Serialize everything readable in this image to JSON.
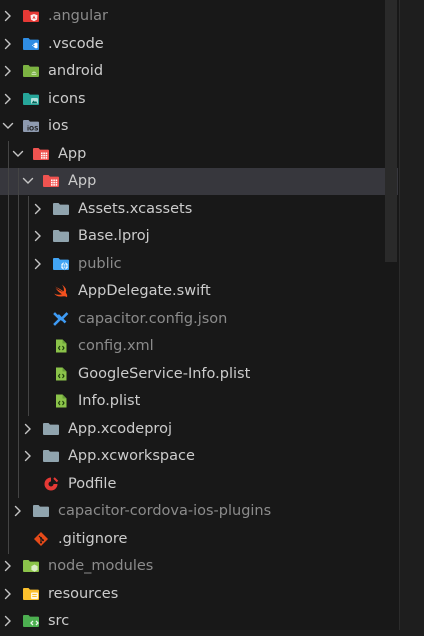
{
  "colors": {
    "background": "#181818",
    "selected_row": "#37373d",
    "text": "#cccccc",
    "text_dim": "#8b8b8b",
    "chevron": "#c5c5c5"
  },
  "tree": {
    "items": [
      {
        "name": "angular-folder",
        "label": ".angular",
        "depth": 0,
        "chevron": "right",
        "icon": "angular-folder-icon",
        "icon_color": "#e53935",
        "dim": true
      },
      {
        "name": "vscode-folder",
        "label": ".vscode",
        "depth": 0,
        "chevron": "right",
        "icon": "vscode-folder-icon",
        "icon_color": "#2f8de4",
        "dim": false
      },
      {
        "name": "android-folder",
        "label": "android",
        "depth": 0,
        "chevron": "right",
        "icon": "android-folder-icon",
        "icon_color": "#7cb342",
        "dim": false
      },
      {
        "name": "icons-folder",
        "label": "icons",
        "depth": 0,
        "chevron": "right",
        "icon": "images-folder-icon",
        "icon_color": "#26a69a",
        "dim": false
      },
      {
        "name": "ios-folder",
        "label": "ios",
        "depth": 0,
        "chevron": "down",
        "icon": "ios-folder-icon",
        "icon_color": "#8e9aaf",
        "dim": false
      },
      {
        "name": "app-folder",
        "label": "App",
        "depth": 1,
        "chevron": "down",
        "icon": "app-folder-icon",
        "icon_color": "#ef5350",
        "dim": false
      },
      {
        "name": "app-subfolder",
        "label": "App",
        "depth": 2,
        "chevron": "down",
        "icon": "app-folder-icon",
        "icon_color": "#ef5350",
        "dim": false,
        "selected": true
      },
      {
        "name": "assets-xcassets-folder",
        "label": "Assets.xcassets",
        "depth": 3,
        "chevron": "right",
        "icon": "folder-icon",
        "icon_color": "#90a4ae",
        "dim": false
      },
      {
        "name": "base-lproj-folder",
        "label": "Base.lproj",
        "depth": 3,
        "chevron": "right",
        "icon": "folder-icon",
        "icon_color": "#90a4ae",
        "dim": false
      },
      {
        "name": "public-folder",
        "label": "public",
        "depth": 3,
        "chevron": "right",
        "icon": "public-folder-icon",
        "icon_color": "#42a5f5",
        "dim": true
      },
      {
        "name": "appdelegate-file",
        "label": "AppDelegate.swift",
        "depth": 3,
        "chevron": "none",
        "icon": "swift-icon",
        "icon_color": "#f4511e",
        "dim": false
      },
      {
        "name": "capacitor-config-file",
        "label": "capacitor.config.json",
        "depth": 3,
        "chevron": "none",
        "icon": "capacitor-icon",
        "icon_color": "#3e9bf5",
        "dim": true
      },
      {
        "name": "config-xml-file",
        "label": "config.xml",
        "depth": 3,
        "chevron": "none",
        "icon": "xml-file-icon",
        "icon_color": "#8bc34a",
        "dim": true
      },
      {
        "name": "googleservice-plist-file",
        "label": "GoogleService-Info.plist",
        "depth": 3,
        "chevron": "none",
        "icon": "plist-file-icon",
        "icon_color": "#8bc34a",
        "dim": false
      },
      {
        "name": "info-plist-file",
        "label": "Info.plist",
        "depth": 3,
        "chevron": "none",
        "icon": "plist-file-icon",
        "icon_color": "#8bc34a",
        "dim": false
      },
      {
        "name": "app-xcodeproj-folder",
        "label": "App.xcodeproj",
        "depth": 2,
        "chevron": "right",
        "icon": "folder-icon",
        "icon_color": "#90a4ae",
        "dim": false
      },
      {
        "name": "app-xcworkspace-folder",
        "label": "App.xcworkspace",
        "depth": 2,
        "chevron": "right",
        "icon": "folder-icon",
        "icon_color": "#90a4ae",
        "dim": false
      },
      {
        "name": "podfile-file",
        "label": "Podfile",
        "depth": 2,
        "chevron": "none",
        "icon": "cocoapods-icon",
        "icon_color": "#e53935",
        "dim": false
      },
      {
        "name": "capacitor-cordova-ios-plugins-folder",
        "label": "capacitor-cordova-ios-plugins",
        "depth": 1,
        "chevron": "right",
        "icon": "folder-icon",
        "icon_color": "#90a4ae",
        "dim": true
      },
      {
        "name": "gitignore-file",
        "label": ".gitignore",
        "depth": 1,
        "chevron": "none",
        "icon": "git-icon",
        "icon_color": "#e64a19",
        "dim": false
      },
      {
        "name": "node-modules-folder",
        "label": "node_modules",
        "depth": 0,
        "chevron": "right",
        "icon": "node-folder-icon",
        "icon_color": "#8bc34a",
        "dim": true
      },
      {
        "name": "resources-folder",
        "label": "resources",
        "depth": 0,
        "chevron": "right",
        "icon": "resources-folder-icon",
        "icon_color": "#fbc02d",
        "dim": false
      },
      {
        "name": "src-folder",
        "label": "src",
        "depth": 0,
        "chevron": "right",
        "icon": "src-folder-icon",
        "icon_color": "#4caf50",
        "dim": false
      }
    ]
  }
}
